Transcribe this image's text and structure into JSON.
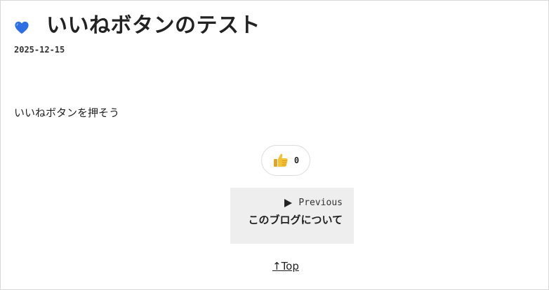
{
  "post": {
    "title": "いいねボタンのテスト",
    "date": "2025-12-15",
    "heart_icon": "blue-heart-icon",
    "heart_color": "#2f6fe4",
    "body": "いいねボタンを押そう"
  },
  "like": {
    "icon": "thumbs-up-icon",
    "count": "0"
  },
  "navigation": {
    "previous_label": "Previous",
    "previous_icon": "play-triangle-icon",
    "previous_title": "このブログについて",
    "top_label": "↑Top"
  }
}
